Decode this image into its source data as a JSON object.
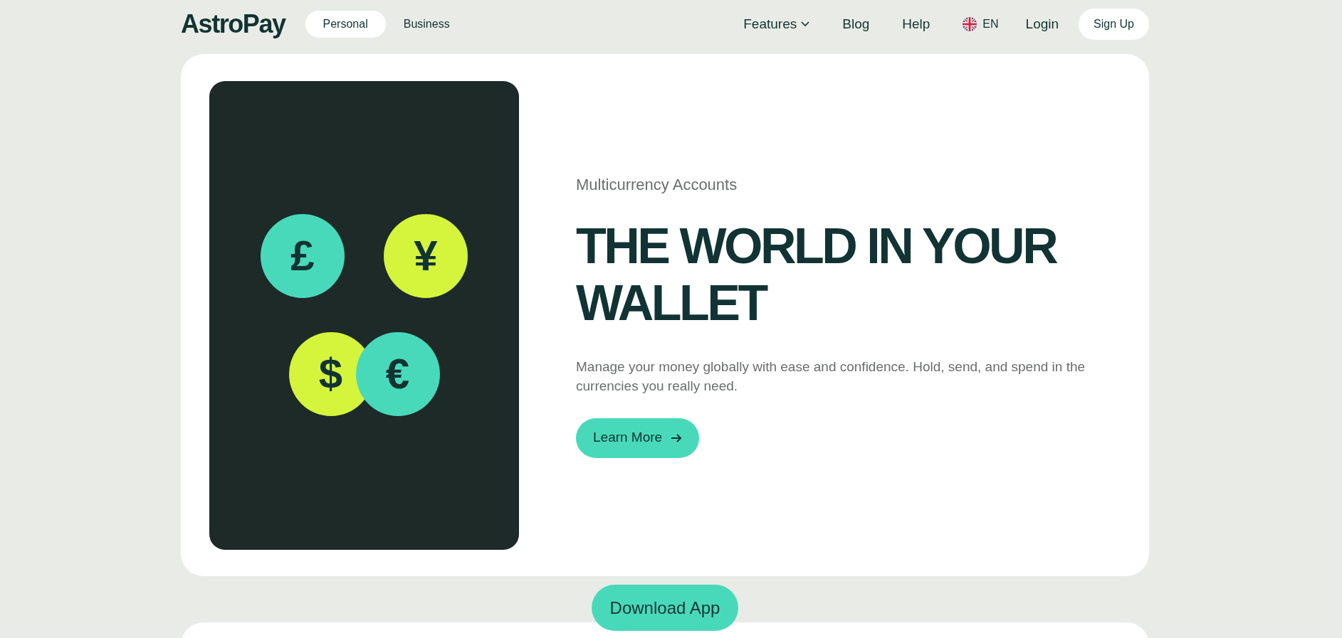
{
  "header": {
    "logo": "AstroPay",
    "segments": [
      {
        "label": "Personal",
        "selected": true
      },
      {
        "label": "Business",
        "selected": false
      }
    ],
    "nav": [
      {
        "label": "Features",
        "kind": "dropdown"
      },
      {
        "label": "Blog",
        "kind": "link"
      },
      {
        "label": "Help",
        "kind": "link"
      }
    ],
    "language": "EN",
    "login": "Login",
    "signup": "Sign Up"
  },
  "hero": {
    "coins": [
      {
        "symbol": "£",
        "color": "#48d9bb"
      },
      {
        "symbol": "¥",
        "color": "#d4f53c"
      },
      {
        "symbol": "$",
        "color": "#d4f53c"
      },
      {
        "symbol": "€",
        "color": "#48d9bb"
      }
    ],
    "eyebrow": "Multicurrency Accounts",
    "heading": "THE WORLD IN YOUR WALLET",
    "body": "Manage your money globally with ease and confidence. Hold, send, and spend in the currencies you really need.",
    "cta": "Learn More"
  },
  "download_button": "Download App"
}
